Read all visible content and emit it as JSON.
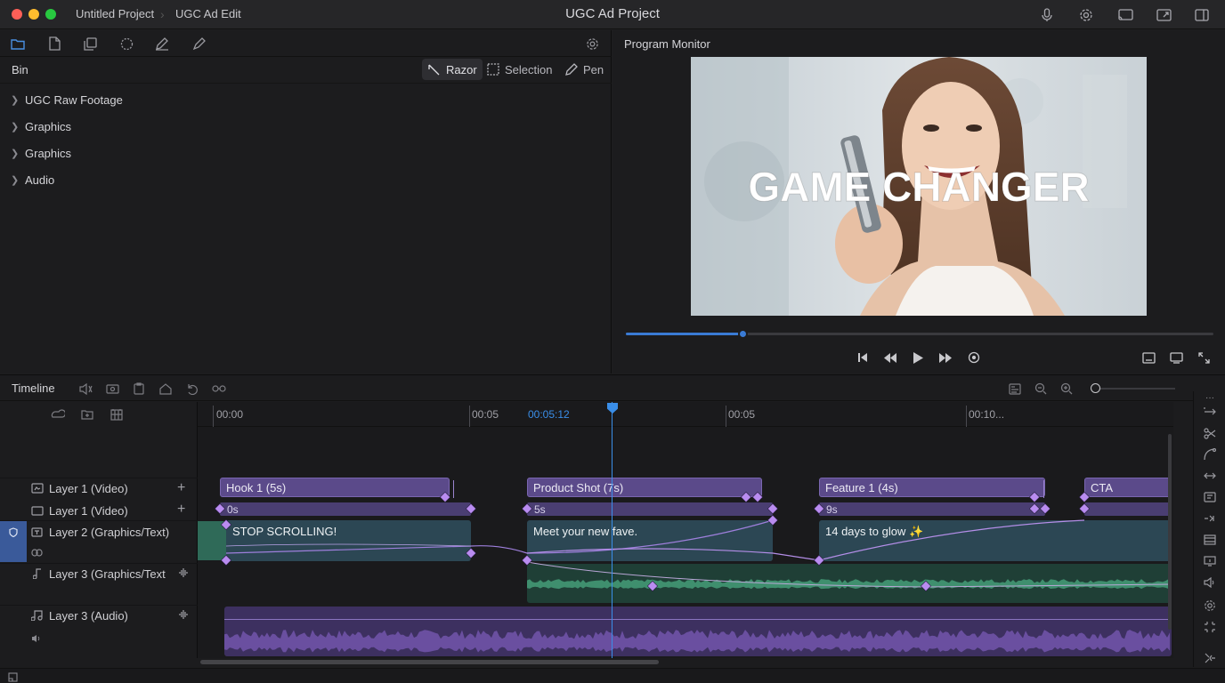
{
  "titlebar": {
    "project_name": "Untitled Project",
    "edit_name": "UGC Ad Edit",
    "app_title": "UGC Ad Project",
    "traffic_colors": [
      "#ff5f57",
      "#febc2e",
      "#28c840"
    ]
  },
  "left_toolbar": {
    "icons": [
      "folder-icon",
      "document-icon",
      "copy-icon",
      "lasso-icon",
      "pencil-icon",
      "brush-icon",
      "gear-icon"
    ]
  },
  "bin": {
    "label": "Bin",
    "tools": [
      {
        "label": "Razor",
        "icon": "razor-icon",
        "active": true
      },
      {
        "label": "Selection",
        "icon": "selection-icon",
        "active": false
      },
      {
        "label": "Pen",
        "icon": "pen-icon",
        "active": false
      }
    ],
    "items": [
      {
        "label": "UGC Raw Footage"
      },
      {
        "label": "Graphics"
      },
      {
        "label": "Graphics"
      },
      {
        "label": "Audio"
      }
    ]
  },
  "monitor": {
    "title": "Program Monitor",
    "overlay_text": "GAME CHANGER",
    "scrub_progress": 0.198,
    "accent": "#3a7bd5"
  },
  "timeline": {
    "title": "Timeline",
    "ruler": {
      "marks": [
        "00:00",
        "00:05",
        "00:05",
        "00:10..."
      ],
      "playhead_time": "00:05:12"
    },
    "tracks": [
      {
        "label": "Layer 1 (Video)",
        "icon": "video-icon",
        "action": "+"
      },
      {
        "label": "Layer 1 (Video)",
        "icon": "monitor-icon",
        "action": "+"
      },
      {
        "label": "Layer 2 (Graphics/Text)",
        "icon": "text-icon"
      },
      {
        "label": "Layer 3 (Graphics/Text",
        "icon": "music-note-icon"
      },
      {
        "label": "Layer 3 (Audio)",
        "icon": "music-note-icon"
      }
    ],
    "video_clips": [
      {
        "label": "Hook 1 (5s)"
      },
      {
        "label": "Product Shot (7s)"
      },
      {
        "label": "Feature 1 (4s)"
      },
      {
        "label": "CTA"
      }
    ],
    "keyframe_lanes": [
      {
        "label": "0s"
      },
      {
        "label": "5s"
      },
      {
        "label": "9s"
      }
    ],
    "text_clips": [
      {
        "label": "STOP SCROLLING!"
      },
      {
        "label": "Meet your new fave."
      },
      {
        "label": "14 days to glow ✨"
      }
    ],
    "colors": {
      "clip_purple": "#5b4a8a",
      "keyframe": "#b98cf0",
      "audio_green": "#3f8f6e",
      "audio_purple": "#6a4fa0",
      "playhead": "#3a8ee8"
    }
  }
}
